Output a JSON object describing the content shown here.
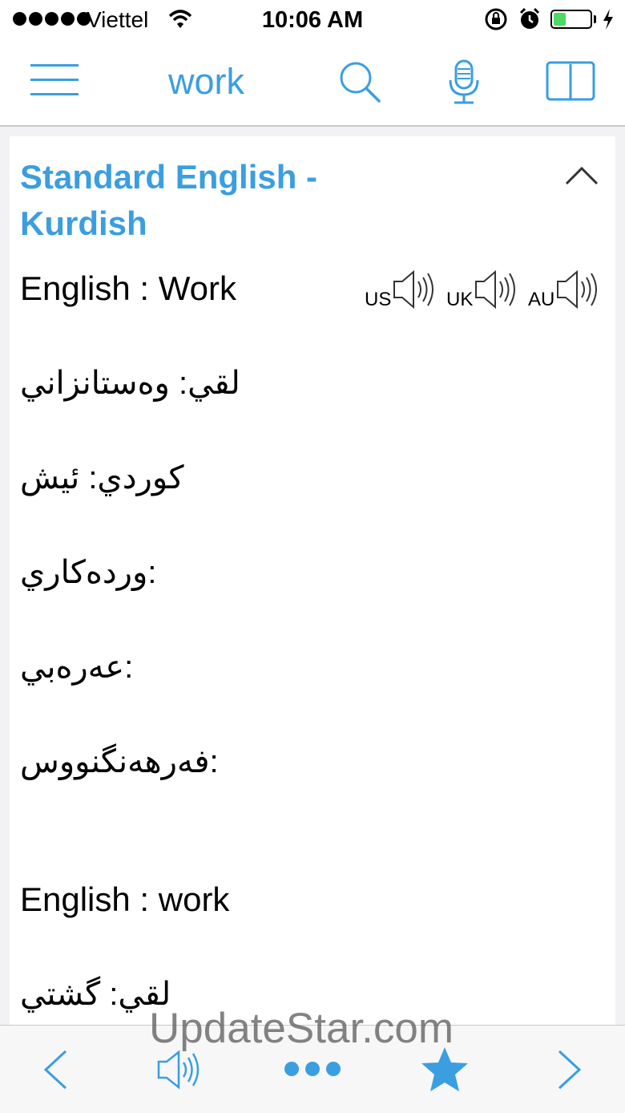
{
  "status_bar": {
    "carrier": "Viettel",
    "time": "10:06 AM",
    "signal_bars": 5,
    "battery_level": 0.35,
    "icons": [
      "wifi-icon",
      "rotation-lock-icon",
      "alarm-icon",
      "battery-icon",
      "charging-icon"
    ]
  },
  "nav": {
    "title": "work",
    "icons": [
      "menu-icon",
      "search-icon",
      "microphone-icon",
      "book-icon"
    ]
  },
  "card": {
    "heading": "Standard English - Kurdish",
    "entries": [
      {
        "title": "English : Work",
        "pronunciations": [
          "US",
          "UK",
          "AU"
        ],
        "lines": [
          "لقي: وەستانزاني",
          "كوردي: ئيش",
          "وردەكاري:",
          "عەرەبي:",
          "فەرهەنگنووس:"
        ]
      },
      {
        "title": "English : work",
        "lines": [
          "لقي: گشتي"
        ]
      }
    ]
  },
  "toolbar": {
    "icons": [
      "back-chevron-icon",
      "speaker-icon",
      "more-icon",
      "star-icon",
      "forward-chevron-icon"
    ]
  },
  "watermark": "UpdateStar.com",
  "colors": {
    "accent": "#3a9ee0",
    "battery": "#4cd964"
  }
}
